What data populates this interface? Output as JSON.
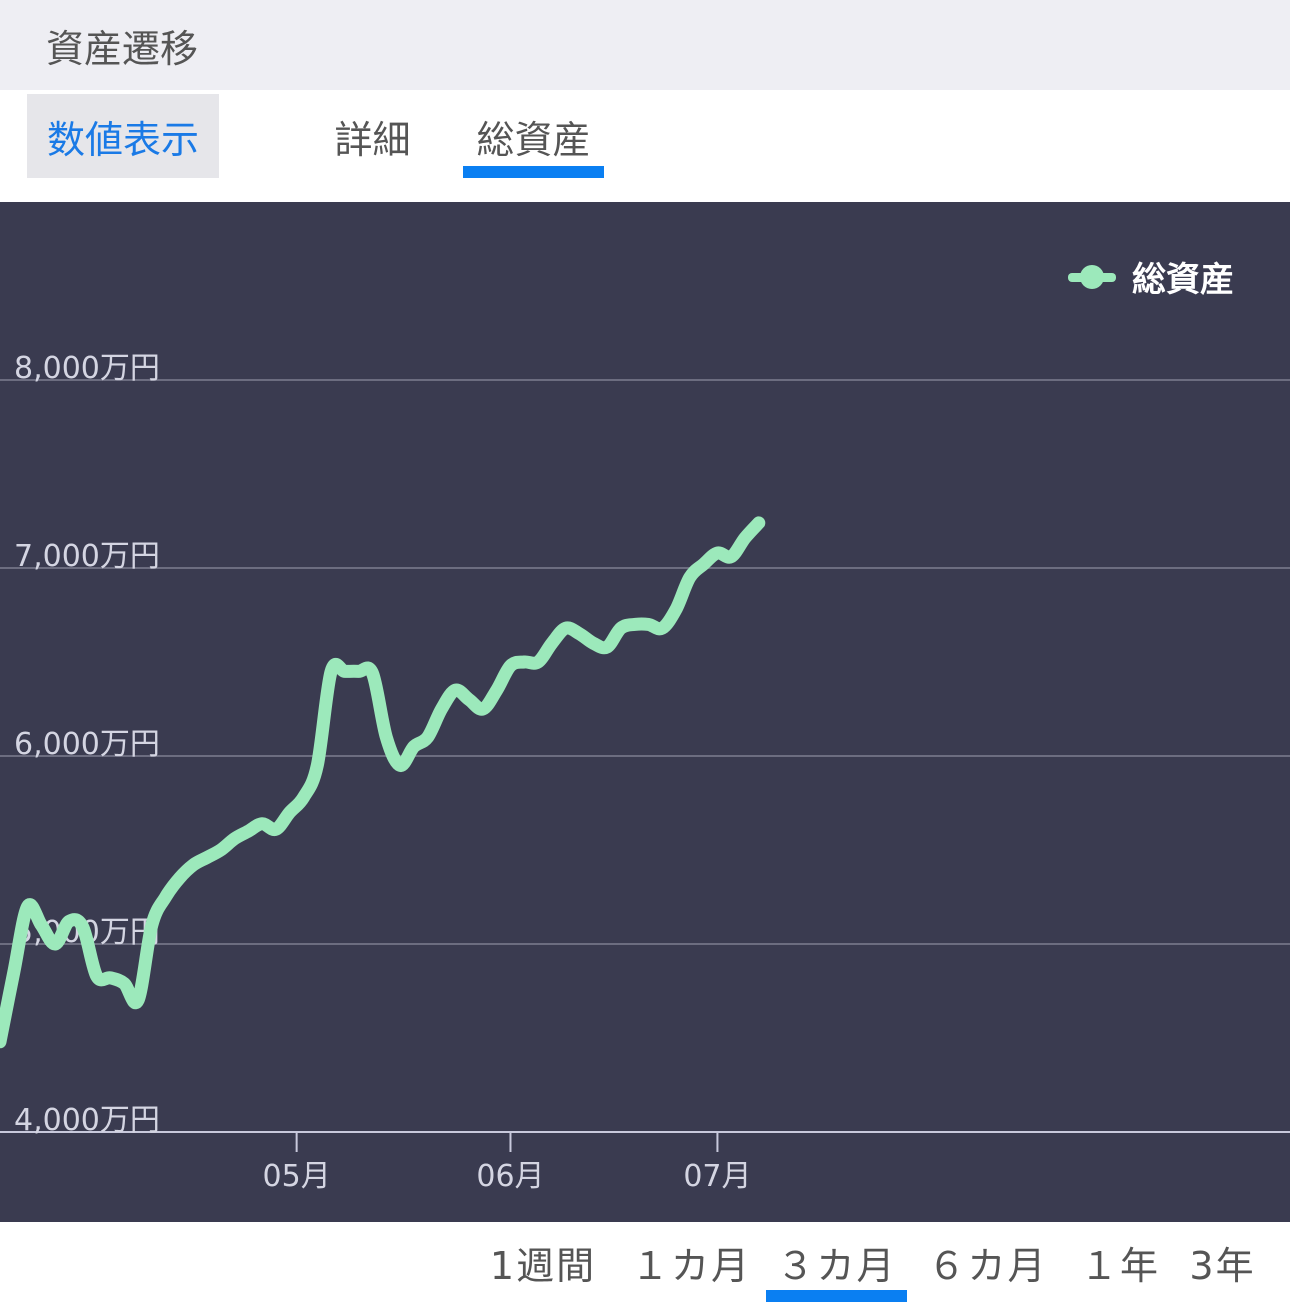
{
  "section": {
    "title": "資産遷移"
  },
  "tabs": {
    "numeric": "数値表示",
    "items": [
      {
        "label": "詳細",
        "active": false
      },
      {
        "label": "総資産",
        "active": true
      }
    ]
  },
  "chart_data": {
    "type": "line",
    "legend": "総資産",
    "legend_position": "top-right",
    "line_color": "#9ce9bb",
    "background": "#3a3b50",
    "accent_color": "#0a7ff2",
    "y_unit": "万円",
    "ylim": [
      4000,
      8000
    ],
    "y_ticks": [
      {
        "value": 8000,
        "label": "8,000万円"
      },
      {
        "value": 7000,
        "label": "7,000万円"
      },
      {
        "value": 6000,
        "label": "6,000万円"
      },
      {
        "value": 5000,
        "label": "5,000万円"
      },
      {
        "value": 4000,
        "label": "4,000万円"
      }
    ],
    "xlim": [
      -43,
      144
    ],
    "x_ticks": [
      {
        "value": 0,
        "label": "05月"
      },
      {
        "value": 31,
        "label": "06月"
      },
      {
        "value": 61,
        "label": "07月"
      }
    ],
    "grid": true,
    "series": [
      {
        "name": "総資産",
        "x": [
          -43,
          -41,
          -39,
          -37,
          -35,
          -33,
          -31,
          -29,
          -27,
          -25,
          -23,
          -21,
          -19,
          -17,
          -15,
          -13,
          -11,
          -9,
          -7,
          -5,
          -3,
          -1,
          1,
          3,
          5,
          7,
          9,
          11,
          13,
          15,
          17,
          19,
          21,
          23,
          25,
          27,
          29,
          31,
          33,
          35,
          37,
          39,
          41,
          43,
          45,
          47,
          49,
          51,
          53,
          55,
          57,
          59,
          61,
          63,
          65,
          67
        ],
        "values": [
          4480,
          4850,
          5200,
          5100,
          5000,
          5120,
          5090,
          4830,
          4820,
          4790,
          4700,
          5100,
          5250,
          5350,
          5420,
          5460,
          5500,
          5560,
          5600,
          5640,
          5610,
          5700,
          5780,
          5950,
          6450,
          6450,
          6450,
          6440,
          6100,
          5950,
          6050,
          6100,
          6250,
          6350,
          6300,
          6250,
          6350,
          6480,
          6500,
          6500,
          6600,
          6680,
          6650,
          6600,
          6580,
          6680,
          6700,
          6700,
          6680,
          6780,
          6950,
          7020,
          7080,
          7060,
          7160,
          7240
        ]
      }
    ]
  },
  "periods": [
    {
      "label": "1週間",
      "active": false
    },
    {
      "label": "１カ月",
      "active": false
    },
    {
      "label": "３カ月",
      "active": true
    },
    {
      "label": "６カ月",
      "active": false
    },
    {
      "label": "１年",
      "active": false
    },
    {
      "label": "3年",
      "active": false
    }
  ]
}
